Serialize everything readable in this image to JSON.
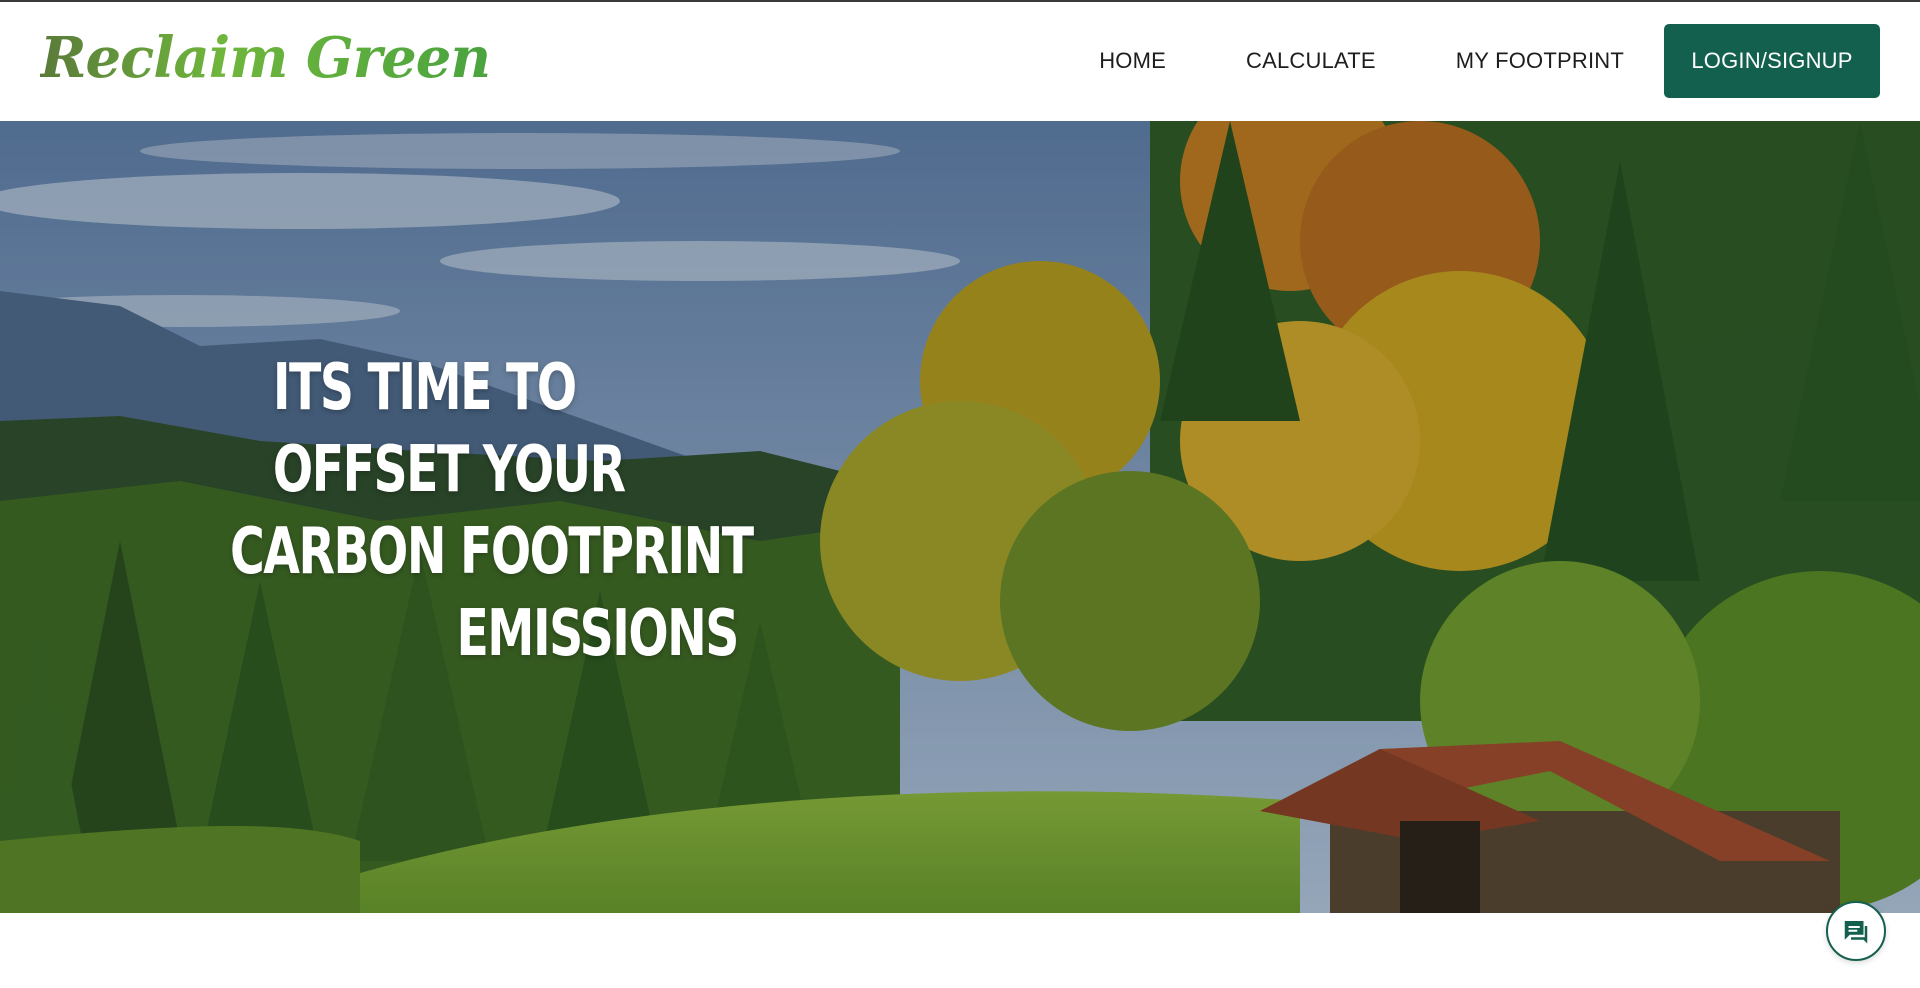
{
  "brand": {
    "logo_text": "Reclaim Green"
  },
  "nav": {
    "items": [
      {
        "label": "HOME"
      },
      {
        "label": "CALCULATE"
      },
      {
        "label": "MY FOOTPRINT"
      }
    ],
    "login_label": "LOGIN/SIGNUP"
  },
  "hero": {
    "lines": [
      "ITS TIME TO",
      "OFFSET YOUR",
      "CARBON FOOTPRINT",
      "EMISSIONS"
    ]
  },
  "chat": {
    "icon": "chat-bubble-icon"
  },
  "colors": {
    "accent": "#14604f",
    "logo_green": "#6fb63c",
    "nav_text": "#1d1d1d",
    "hero_text": "#ffffff"
  }
}
